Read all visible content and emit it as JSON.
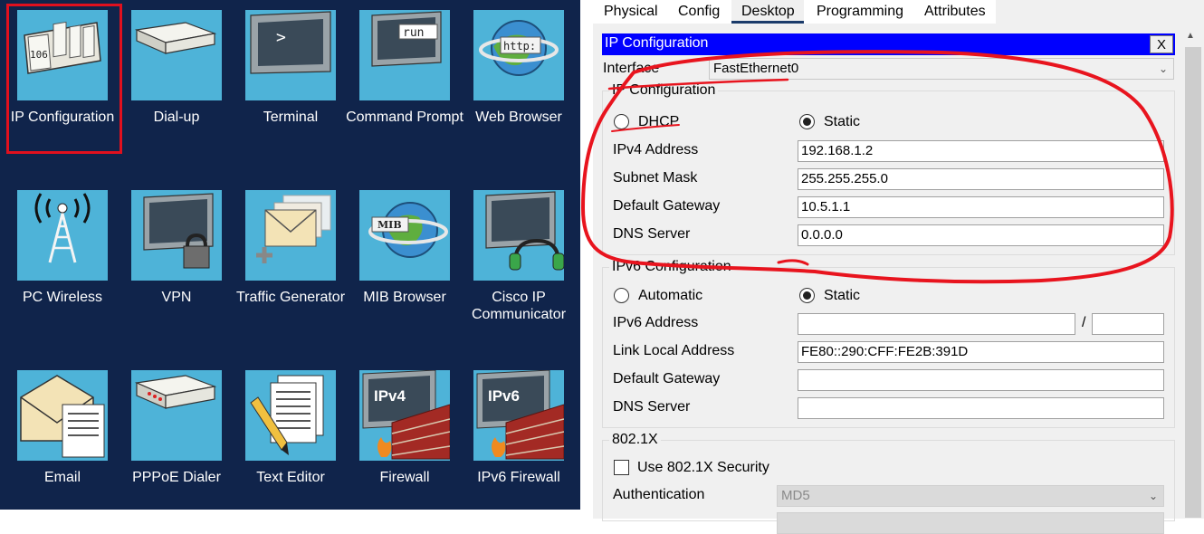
{
  "apps": [
    {
      "id": "ip-configuration",
      "label": "IP Configuration"
    },
    {
      "id": "dial-up",
      "label": "Dial-up"
    },
    {
      "id": "terminal",
      "label": "Terminal"
    },
    {
      "id": "command-prompt",
      "label": "Command Prompt"
    },
    {
      "id": "web-browser",
      "label": "Web Browser"
    },
    {
      "id": "pc-wireless",
      "label": "PC Wireless"
    },
    {
      "id": "vpn",
      "label": "VPN"
    },
    {
      "id": "traffic-generator",
      "label": "Traffic Generator"
    },
    {
      "id": "mib-browser",
      "label": "MIB Browser"
    },
    {
      "id": "cisco-ip-communicator",
      "label": "Cisco IP Communicator"
    },
    {
      "id": "email",
      "label": "Email"
    },
    {
      "id": "pppoe-dialer",
      "label": "PPPoE Dialer"
    },
    {
      "id": "text-editor",
      "label": "Text Editor"
    },
    {
      "id": "firewall",
      "label": "Firewall"
    },
    {
      "id": "ipv6-firewall",
      "label": "IPv6 Firewall"
    }
  ],
  "icon_texts": {
    "ip_config": "106",
    "terminal": ">",
    "command": "run",
    "web": "http:",
    "mib": "MIB",
    "ipv4": "IPv4",
    "ipv6": "IPv6"
  },
  "tabs": [
    "Physical",
    "Config",
    "Desktop",
    "Programming",
    "Attributes"
  ],
  "active_tab": "Desktop",
  "window": {
    "title": "IP Configuration",
    "close": "X"
  },
  "interface": {
    "label": "Interface",
    "value": "FastEthernet0"
  },
  "ipv4": {
    "group_title": "IP Configuration",
    "dhcp_label": "DHCP",
    "static_label": "Static",
    "mode": "Static",
    "address_label": "IPv4 Address",
    "address": "192.168.1.2",
    "mask_label": "Subnet Mask",
    "mask": "255.255.255.0",
    "gateway_label": "Default Gateway",
    "gateway": "10.5.1.1",
    "dns_label": "DNS Server",
    "dns": "0.0.0.0"
  },
  "ipv6": {
    "group_title": "IPv6 Configuration",
    "automatic_label": "Automatic",
    "static_label": "Static",
    "mode": "Static",
    "address_label": "IPv6 Address",
    "address": "",
    "slash": "/",
    "prefix": "",
    "link_local_label": "Link Local Address",
    "link_local": "FE80::290:CFF:FE2B:391D",
    "gateway_label": "Default Gateway",
    "gateway": "",
    "dns_label": "DNS Server",
    "dns": ""
  },
  "dot1x": {
    "group_title": "802.1X",
    "use_label": "Use 802.1X Security",
    "checked": false,
    "auth_label": "Authentication",
    "auth_value": "MD5"
  },
  "colors": {
    "desktop_bg": "#10244b",
    "tile": "#4eb3d8",
    "highlight": "#e0101e",
    "titlebar": "#0000ff",
    "scribble": "#e8141e"
  }
}
